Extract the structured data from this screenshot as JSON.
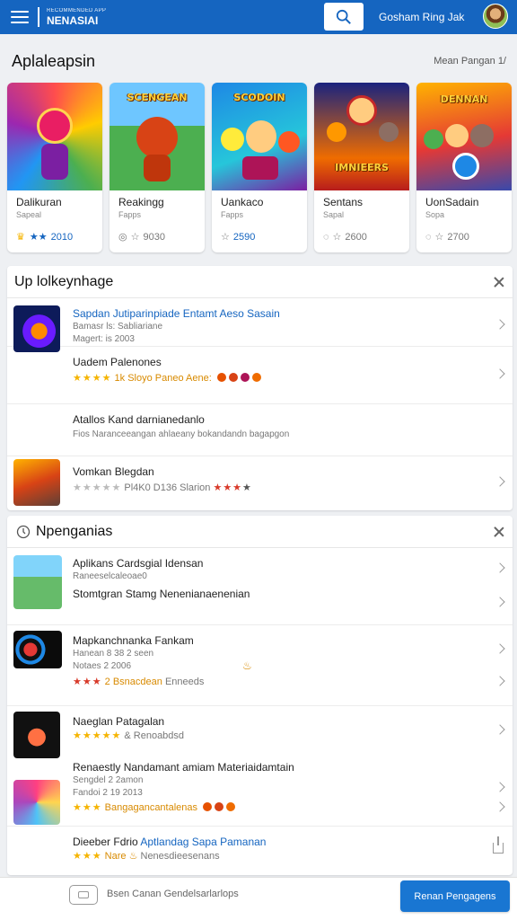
{
  "header": {
    "brand_small": "RECOMMENDED APP",
    "brand_big": "NENASIAI",
    "right_label": "Gosham Ring Jak"
  },
  "featured": {
    "title": "Aplaleapsin",
    "link": "Mean Pangan 1/",
    "cards": [
      {
        "banner": "",
        "title": "Dalikuran",
        "sub": "Sapeal",
        "rating": "2010"
      },
      {
        "banner": "SCENGEAN",
        "title": "Reakingg",
        "sub": "Fapps",
        "rating": "9030"
      },
      {
        "banner": "SCODOIN",
        "title": "Uankaco",
        "sub": "Fapps",
        "rating": "2590"
      },
      {
        "banner": "IMNIEERS",
        "title": "Sentans",
        "sub": "Sapal",
        "rating": "2600"
      },
      {
        "banner": "DENNAN",
        "title": "UonSadain",
        "sub": "Sopa",
        "rating": "2700"
      }
    ]
  },
  "updates": {
    "title": "Up lolkeynhage",
    "items": [
      {
        "line1": "Sapdan Jutiparinpiade Entamt Aeso Sasain",
        "line2": "Bamasr ls: Sabliariane",
        "line3": "Magert: is 2003"
      },
      {
        "line1": "Uadem Palenones",
        "stars": "★★★★",
        "line2": "1k Sloyo Paneo Aene:"
      },
      {
        "line1": "Atallos Kand darnianedanlo",
        "line2": "Fios Naranceeangan ahlaeany bokandandn bagapgon"
      },
      {
        "line1": "Vomkan Blegdan",
        "stars": "★★★★★",
        "line2": "Pl4K0 D136 Slarion"
      }
    ]
  },
  "recommend": {
    "title": "Npenganias",
    "items": [
      {
        "line1": "Aplikans Cardsgial Idensan",
        "line2": "Raneeselcaleoae0"
      },
      {
        "line1": "Stomtgran Stamg Nenenianaenenian"
      },
      {
        "line1": "Mapkanchnanka Fankam",
        "line2": "Hanean 8 38 2 seen",
        "line3": "Notaes 2 2006",
        "stars": "★★★",
        "extra": "2 Bsnacdean",
        "extra2": "Enneeds"
      },
      {
        "line1": "Naeglan Patagalan",
        "stars": "★★★★★",
        "line2": "& Renoabdsd"
      },
      {
        "line1": "Renaestly Nandamant amiam Materiaidamtain",
        "line2": "Sengdel 2 2amon",
        "line3": "Fandoi 2 19 2013",
        "stars": "★★★",
        "extra": "Bangagancantalenas"
      },
      {
        "line1": "Dieeber Fdrio",
        "line1b": "Aptlandag Sapa Pamanan",
        "stars": "★★★",
        "line2": "Nare",
        "extra": "Nenesdieesenans"
      }
    ]
  },
  "bottom": {
    "text": "Bsen Canan Gendelsarlarlops",
    "cta": "Renan Pengagens"
  },
  "colors": {
    "primary": "#1565c0",
    "star": "#f5b400"
  }
}
